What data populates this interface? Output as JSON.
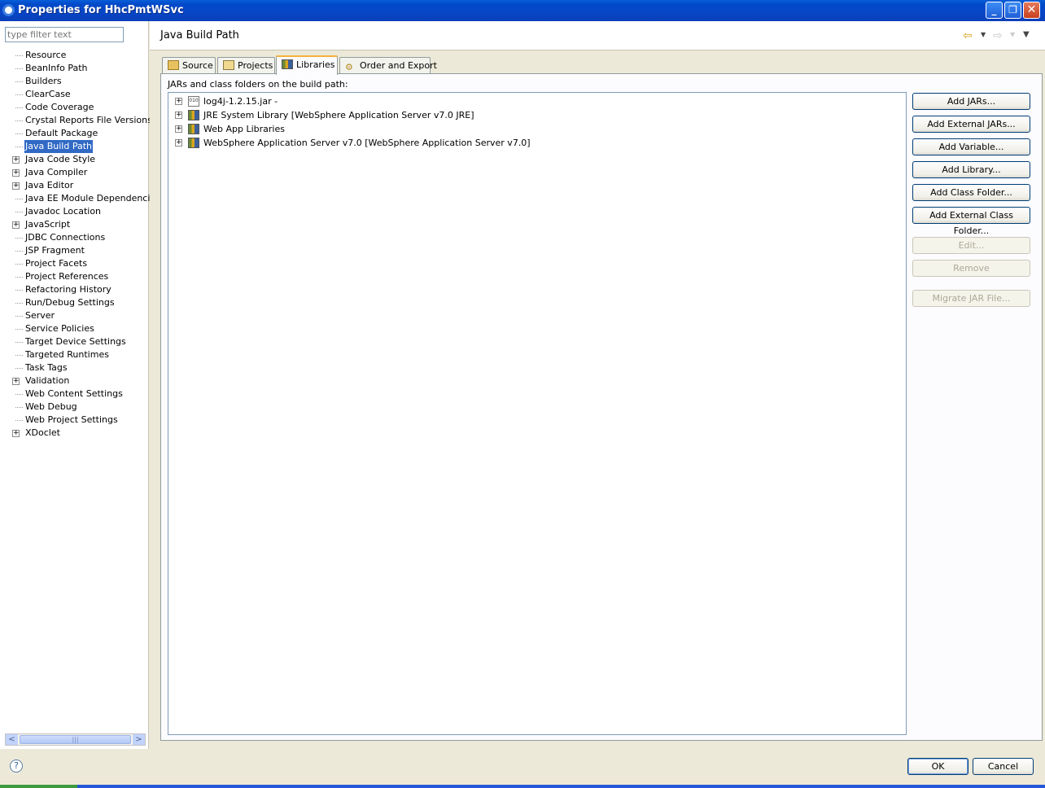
{
  "window": {
    "title": "Properties for HhcPmtWSvc"
  },
  "filter": {
    "placeholder": "type filter text"
  },
  "nav": {
    "items": [
      {
        "label": "Resource",
        "expandable": false
      },
      {
        "label": "BeanInfo Path",
        "expandable": false
      },
      {
        "label": "Builders",
        "expandable": false
      },
      {
        "label": "ClearCase",
        "expandable": false
      },
      {
        "label": "Code Coverage",
        "expandable": false
      },
      {
        "label": "Crystal Reports File Versions",
        "expandable": false
      },
      {
        "label": "Default Package",
        "expandable": false
      },
      {
        "label": "Java Build Path",
        "expandable": false,
        "selected": true
      },
      {
        "label": "Java Code Style",
        "expandable": true
      },
      {
        "label": "Java Compiler",
        "expandable": true
      },
      {
        "label": "Java Editor",
        "expandable": true
      },
      {
        "label": "Java EE Module Dependencies",
        "expandable": false
      },
      {
        "label": "Javadoc Location",
        "expandable": false
      },
      {
        "label": "JavaScript",
        "expandable": true
      },
      {
        "label": "JDBC Connections",
        "expandable": false
      },
      {
        "label": "JSP Fragment",
        "expandable": false
      },
      {
        "label": "Project Facets",
        "expandable": false
      },
      {
        "label": "Project References",
        "expandable": false
      },
      {
        "label": "Refactoring History",
        "expandable": false
      },
      {
        "label": "Run/Debug Settings",
        "expandable": false
      },
      {
        "label": "Server",
        "expandable": false
      },
      {
        "label": "Service Policies",
        "expandable": false
      },
      {
        "label": "Target Device Settings",
        "expandable": false
      },
      {
        "label": "Targeted Runtimes",
        "expandable": false
      },
      {
        "label": "Task Tags",
        "expandable": false
      },
      {
        "label": "Validation",
        "expandable": true
      },
      {
        "label": "Web Content Settings",
        "expandable": false
      },
      {
        "label": "Web Debug",
        "expandable": false
      },
      {
        "label": "Web Project Settings",
        "expandable": false
      },
      {
        "label": "XDoclet",
        "expandable": true
      }
    ]
  },
  "page": {
    "title": "Java Build Path",
    "tabs": [
      {
        "label": "Source",
        "active": false
      },
      {
        "label": "Projects",
        "active": false
      },
      {
        "label": "Libraries",
        "active": true
      },
      {
        "label": "Order and Export",
        "active": false
      }
    ],
    "caption": "JARs and class folders on the build path:",
    "entries": [
      {
        "label": "log4j-1.2.15.jar - ",
        "icon": "jar-icon"
      },
      {
        "label": "JRE System Library [WebSphere Application Server v7.0 JRE]",
        "icon": "library-icon"
      },
      {
        "label": "Web App Libraries",
        "icon": "library-icon"
      },
      {
        "label": "WebSphere Application Server v7.0 [WebSphere Application Server v7.0]",
        "icon": "library-icon"
      }
    ],
    "buttons": [
      {
        "label": "Add JARs...",
        "enabled": true
      },
      {
        "label": "Add External JARs...",
        "enabled": true
      },
      {
        "label": "Add Variable...",
        "enabled": true
      },
      {
        "label": "Add Library...",
        "enabled": true
      },
      {
        "label": "Add Class Folder...",
        "enabled": true
      },
      {
        "label": "Add External Class Folder...",
        "enabled": true
      },
      {
        "label": "Edit...",
        "enabled": false
      },
      {
        "label": "Remove",
        "enabled": false
      },
      {
        "label": "Migrate JAR File...",
        "enabled": false
      }
    ]
  },
  "dialog": {
    "ok_label": "OK",
    "cancel_label": "Cancel",
    "help_glyph": "?"
  }
}
